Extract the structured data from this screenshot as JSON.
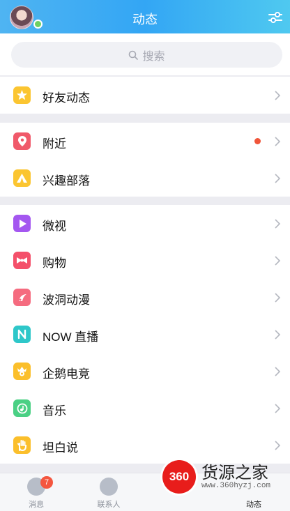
{
  "header": {
    "title": "动态"
  },
  "search": {
    "placeholder": "搜索"
  },
  "groups": [
    {
      "items": [
        {
          "label": "好友动态",
          "color": "#fbc531"
        }
      ]
    },
    {
      "items": [
        {
          "label": "附近",
          "color": "#f0596a",
          "has_dot": true
        },
        {
          "label": "兴趣部落",
          "color": "#fbc531"
        }
      ]
    },
    {
      "items": [
        {
          "label": "微视",
          "color": "#a457f0"
        },
        {
          "label": "购物",
          "color": "#f4506a"
        },
        {
          "label": "波洞动漫",
          "color": "#f56b7f"
        },
        {
          "label": "NOW 直播",
          "color": "#2ec7c9"
        },
        {
          "label": "企鹅电竞",
          "color": "#fbbf2b"
        },
        {
          "label": "音乐",
          "color": "#4ad084"
        },
        {
          "label": "坦白说",
          "color": "#fbbf2b"
        }
      ]
    }
  ],
  "tabbar": {
    "tabs": [
      {
        "label": "消息",
        "badge": "7"
      },
      {
        "label": "联系人"
      },
      {
        "label": ""
      },
      {
        "label": "动态"
      }
    ]
  },
  "watermark": {
    "logo": "360",
    "name": "货源之家",
    "url": "www.360hyzj.com"
  }
}
